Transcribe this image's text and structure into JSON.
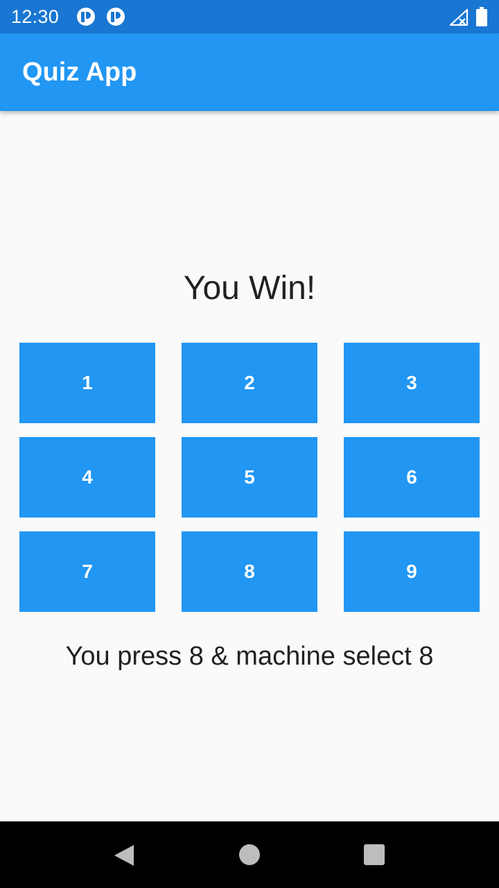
{
  "status_bar": {
    "time": "12:30",
    "icons": [
      "notification-app-icon",
      "notification-app-icon",
      "signal-no-service-icon",
      "battery-icon"
    ]
  },
  "app_bar": {
    "title": "Quiz App"
  },
  "game": {
    "result": "You Win!",
    "buttons": [
      "1",
      "2",
      "3",
      "4",
      "5",
      "6",
      "7",
      "8",
      "9"
    ],
    "summary": "You press 8 & machine select 8"
  },
  "nav_bar": {
    "icons": [
      "back-icon",
      "home-icon",
      "recents-icon"
    ]
  },
  "colors": {
    "status_bar": "#1976d2",
    "app_bar": "#2196f3",
    "button": "#2196f3",
    "background": "#fafafa",
    "text": "#212121",
    "nav_bar": "#000000"
  }
}
